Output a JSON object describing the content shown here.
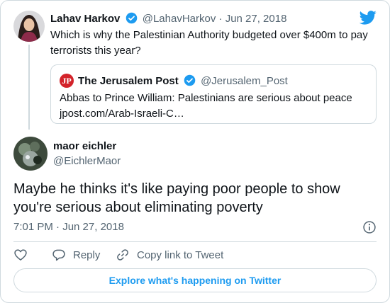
{
  "colors": {
    "brand": "#1d9bf0",
    "text": "#0f1419",
    "muted": "#536471",
    "border": "#cfd9de",
    "jpost_red": "#d3232a"
  },
  "icons": {
    "brand": "twitter-bird-icon",
    "verified": "verified-badge-icon",
    "info": "info-icon",
    "like": "heart-icon",
    "reply": "reply-bubble-icon",
    "copy_link": "link-icon"
  },
  "parent_tweet": {
    "name": "Lahav Harkov",
    "handle": "@LahavHarkov",
    "separator": "·",
    "date": "Jun 27, 2018",
    "text": "Which is why the Palestinian Authority budgeted over $400m to pay terrorists this year?"
  },
  "quoted_tweet": {
    "logo_text": "JP",
    "name": "The Jerusalem Post",
    "handle": "@Jerusalem_Post",
    "text": "Abbas to Prince William: Palestinians are serious about peace",
    "link": "jpost.com/Arab-Israeli-C…"
  },
  "main_tweet": {
    "name": "maor eichler",
    "handle": "@EichlerMaor",
    "text": "Maybe he thinks it's like paying poor people to show you're serious about eliminating poverty",
    "timestamp": "7:01 PM · Jun 27, 2018"
  },
  "actions": {
    "reply_label": "Reply",
    "copy_link_label": "Copy link to Tweet"
  },
  "explore_button": "Explore what's happening on Twitter"
}
